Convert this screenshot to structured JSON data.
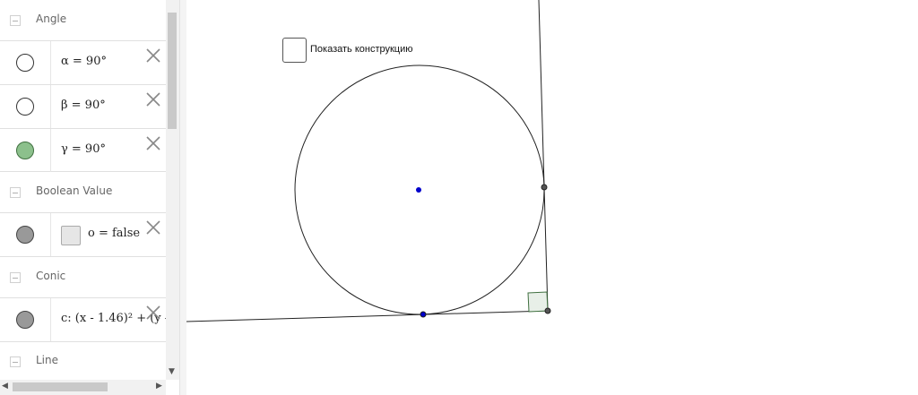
{
  "algebra": {
    "categories": {
      "angle": "Angle",
      "boolean": "Boolean Value",
      "conic": "Conic",
      "line": "Line"
    },
    "items": {
      "alpha": "α = 90°",
      "beta": "β = 90°",
      "gamma": "γ = 90°",
      "bool_o": "o = false",
      "conic_c": "c: (x - 1.46)² + (y - ..."
    }
  },
  "graphics": {
    "show_construction_label": "Показать конструкцию",
    "show_construction_checked": false
  },
  "colors": {
    "gamma_fill": "#8cc08c",
    "center_point": "#0000cc",
    "angle_fill": "#e8efe8"
  },
  "icons": [
    "collapse-icon",
    "delete-icon",
    "checkbox-icon",
    "scroll-arrow-icon"
  ]
}
